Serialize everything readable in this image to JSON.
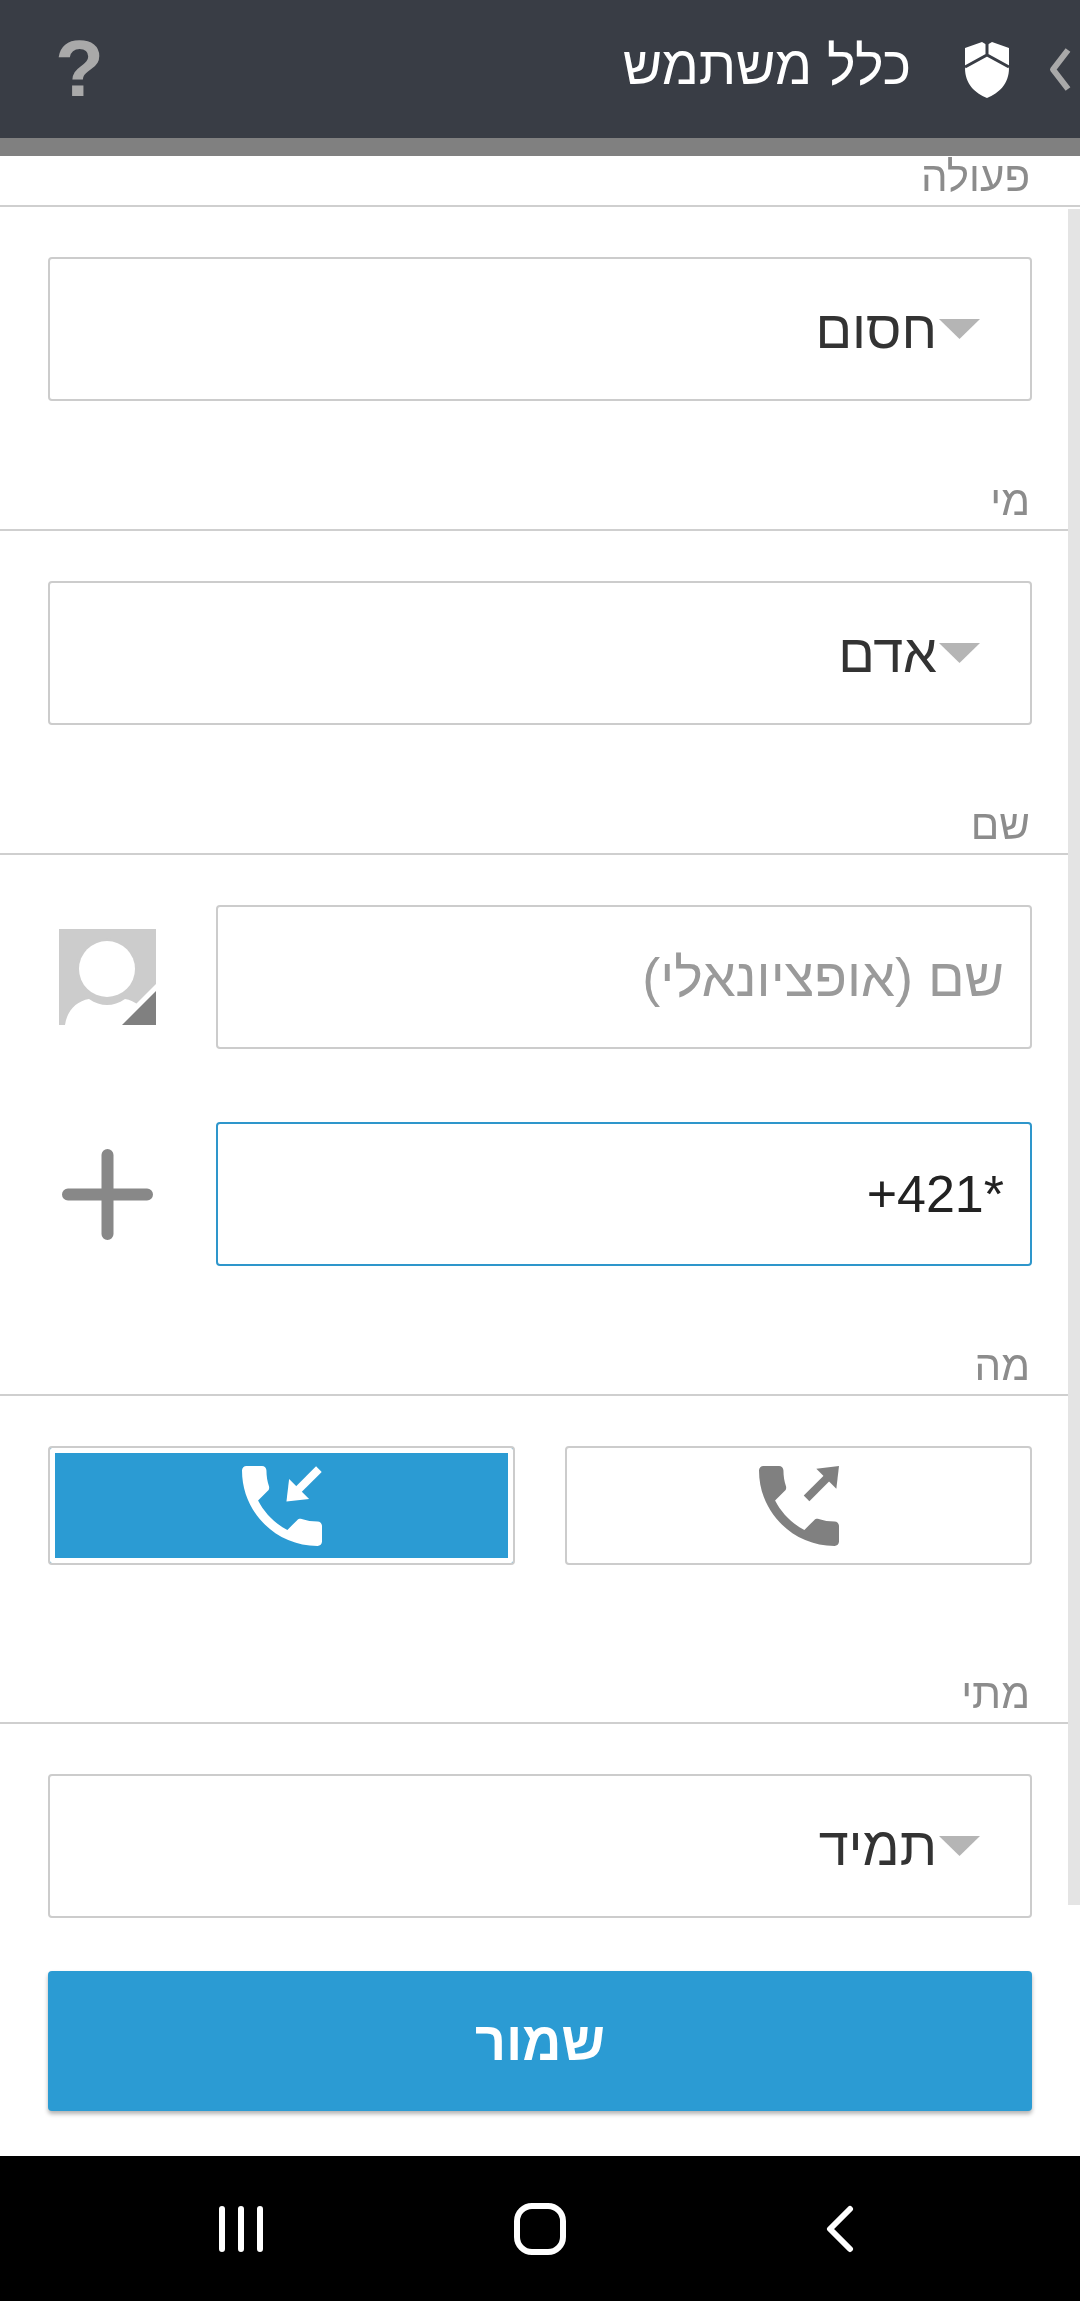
{
  "header": {
    "title": "כלל משתמש",
    "help_label": "?"
  },
  "sections": [
    {
      "kind": "select",
      "label": "פעולה",
      "value": "חסום"
    },
    {
      "kind": "select",
      "label": "מי",
      "value": "אדם"
    },
    {
      "kind": "contact",
      "label": "שם",
      "name_field": {
        "placeholder": "שם (אופציונאלי)"
      },
      "number_field": {
        "value": "+421*",
        "focused": true
      }
    },
    {
      "kind": "call_type",
      "label": "מה",
      "options": [
        {
          "kind": "outgoing",
          "selected": false
        },
        {
          "kind": "incoming",
          "selected": true
        }
      ]
    },
    {
      "kind": "select",
      "label": "מתי",
      "value": "תמיד"
    }
  ],
  "save_button": {
    "label": "שמור"
  }
}
